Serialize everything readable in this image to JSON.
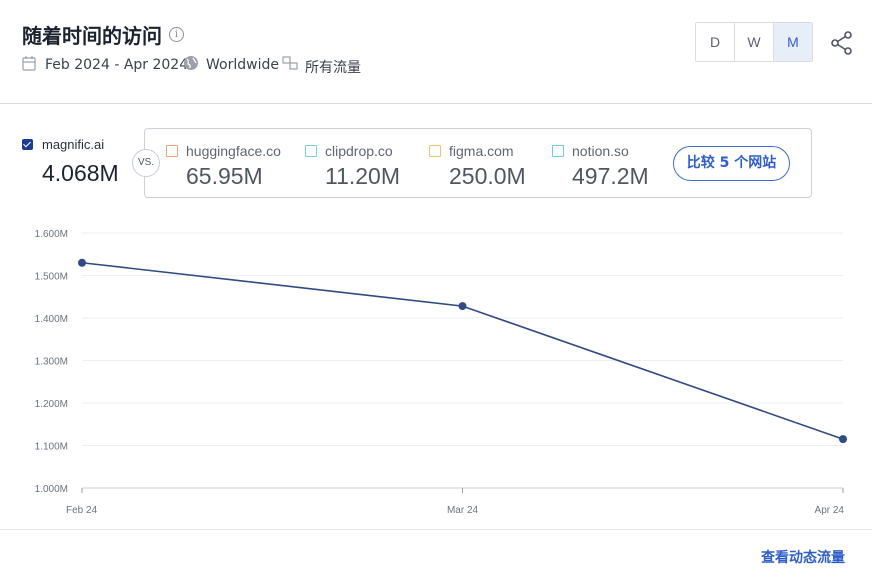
{
  "header": {
    "title": "随着时间的访问",
    "date_range": "Feb 2024 - Apr 2024",
    "region": "Worldwide",
    "traffic_type": "所有流量",
    "granularity": [
      "D",
      "W",
      "M"
    ],
    "granularity_selected": "M"
  },
  "main_site": {
    "name": "magnific.ai",
    "value": "4.068M",
    "checked": true
  },
  "vs_label": "VS.",
  "competitors": [
    {
      "name": "huggingface.co",
      "value": "65.95M",
      "color": "#f0a07a"
    },
    {
      "name": "clipdrop.co",
      "value": "11.20M",
      "color": "#7fd1bd"
    },
    {
      "name": "figma.com",
      "value": "250.0M",
      "color": "#f2c26b"
    },
    {
      "name": "notion.so",
      "value": "497.2M",
      "color": "#6ccde0"
    }
  ],
  "compare_button": "比较 5 个网站",
  "footer_link": "查看动态流量",
  "chart_data": {
    "type": "line",
    "categories": [
      "Feb 24",
      "Mar 24",
      "Apr 24"
    ],
    "series": [
      {
        "name": "magnific.ai",
        "values": [
          1.53,
          1.428,
          1.115
        ],
        "color": "#2f4a85"
      }
    ],
    "yticks": [
      "1.000M",
      "1.100M",
      "1.200M",
      "1.300M",
      "1.400M",
      "1.500M",
      "1.600M"
    ],
    "ylim": [
      1.0,
      1.6
    ],
    "grid": true
  }
}
